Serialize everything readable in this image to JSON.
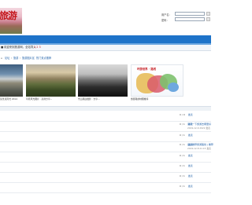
{
  "logo": {
    "title": "旅游",
    "subtitle": ""
  },
  "login": {
    "user_label": "用户名：",
    "pass_label": "密码：",
    "user_value": "",
    "pass_value": ""
  },
  "notice": {
    "prefix": "[",
    "text": "欢迎来到旅游网，全站导入",
    "pages": "1 2 3"
  },
  "breadcrumb": {
    "items": [
      "论坛",
      "旅游",
      "旅游图片区"
    ],
    "extra": "热门景点推荐"
  },
  "gallery": [
    {
      "caption": "某景点风光 2014"
    },
    {
      "caption": "草原风光图片 · 高清分享..."
    },
    {
      "caption": "雪山黑白摄影 · 分享..."
    },
    {
      "caption": "旅游路线地图推荐"
    }
  ],
  "map_poster": {
    "title": "环游世界 · 路线"
  },
  "rows": [
    {
      "replies": "0",
      "views": "0",
      "author": "发表",
      "link": "",
      "date": ""
    },
    {
      "replies": "0",
      "views": "1",
      "author": "发表",
      "link": "请问一下旅游去哪里好",
      "date": "2019-12-6 2022 发表"
    },
    {
      "replies": "0",
      "views": "1",
      "author": "发表",
      "link": "",
      "date": ""
    },
    {
      "replies": "0",
      "views": "1",
      "author": "发表",
      "link": "后台推荐旅游路线 | 推荐",
      "date": "2019-12-8 21:15 发表"
    },
    {
      "replies": "0",
      "views": "1",
      "author": "发表",
      "link": "",
      "date": ""
    },
    {
      "replies": "0",
      "views": "1",
      "author": "发表",
      "link": "",
      "date": ""
    },
    {
      "replies": "0",
      "views": "1",
      "author": "发表",
      "link": "",
      "date": ""
    },
    {
      "replies": "0",
      "views": "1",
      "author": "发表",
      "link": "",
      "date": ""
    }
  ],
  "colors": {
    "nav": "#1e73c9",
    "link": "#1e5fa8",
    "accent": "#c4161c"
  }
}
